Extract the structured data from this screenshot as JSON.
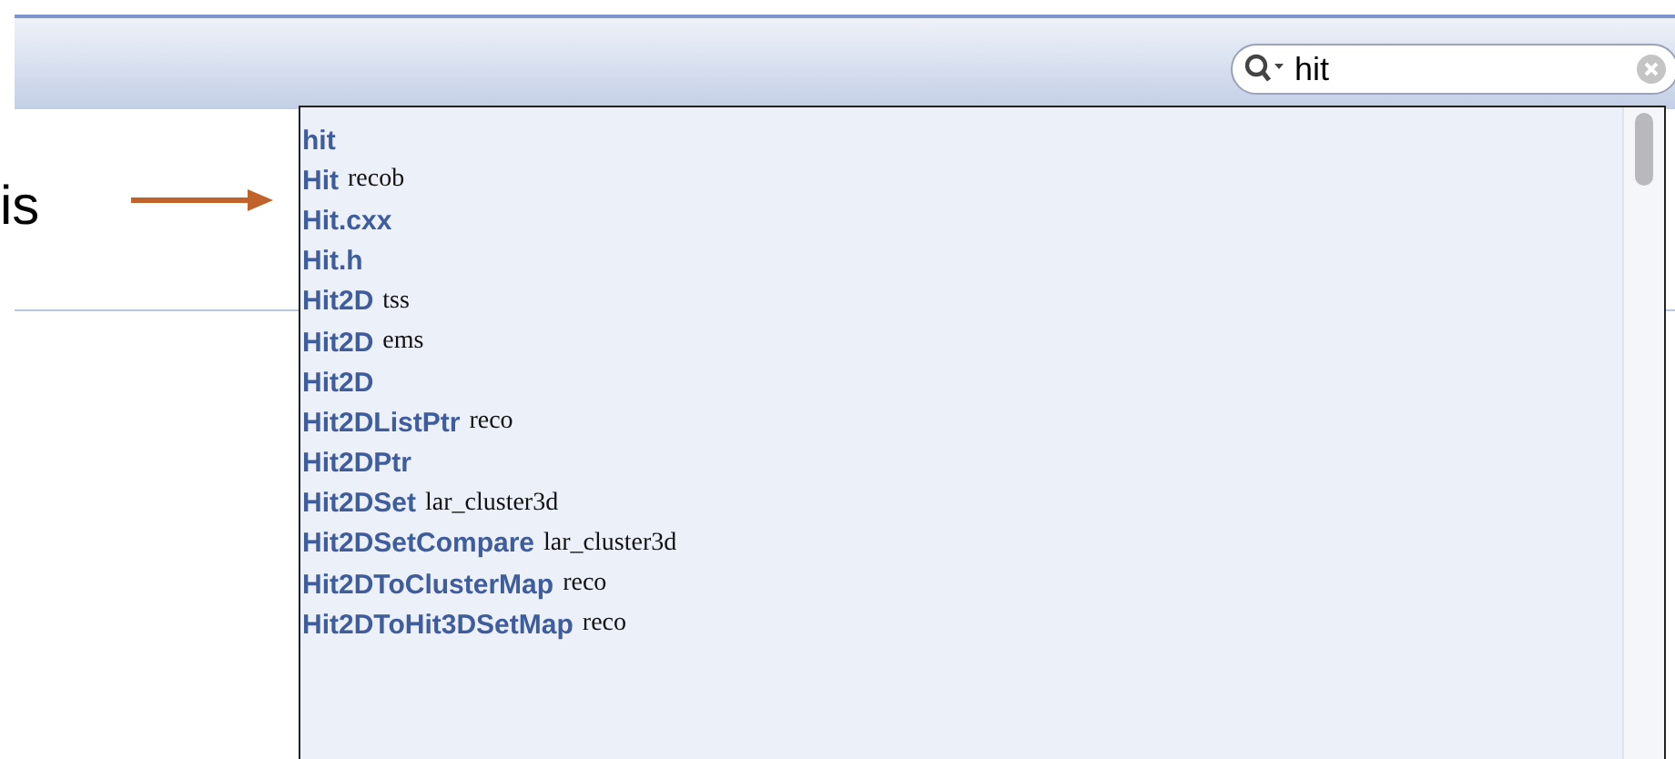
{
  "annotation": {
    "text": "is"
  },
  "search": {
    "value": "hit"
  },
  "results": [
    {
      "name": "hit"
    },
    {
      "name": "Hit",
      "scope": "recob"
    },
    {
      "name": "Hit.cxx"
    },
    {
      "name": "Hit.h"
    },
    {
      "name": "Hit2D",
      "scope": "tss"
    },
    {
      "name": "Hit2D",
      "scope": "ems"
    },
    {
      "name": "Hit2D"
    },
    {
      "name": "Hit2DListPtr",
      "scope": "reco"
    },
    {
      "name": "Hit2DPtr"
    },
    {
      "name": "Hit2DSet",
      "scope": "lar_cluster3d"
    },
    {
      "name": "Hit2DSetCompare",
      "scope": "lar_cluster3d"
    },
    {
      "name": "Hit2DToClusterMap",
      "scope": "reco"
    },
    {
      "name": "Hit2DToHit3DSetMap",
      "scope": "reco"
    }
  ]
}
